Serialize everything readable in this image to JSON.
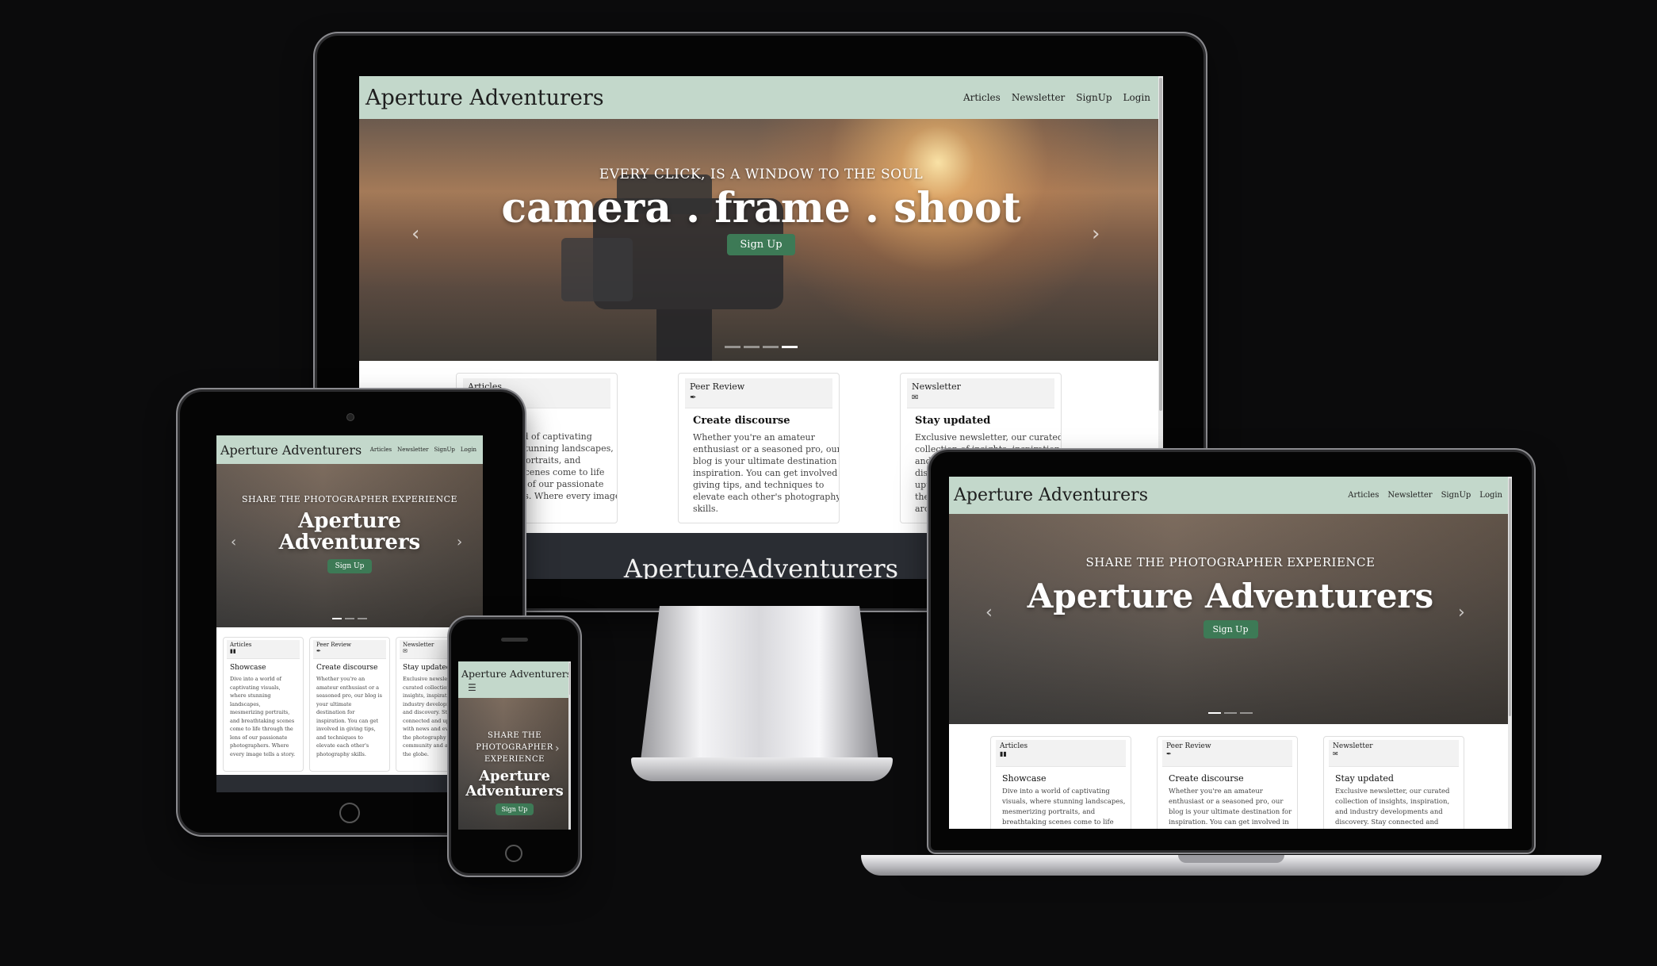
{
  "site": {
    "brand": "Aperture Adventurers",
    "nav": [
      "Articles",
      "Newsletter",
      "SignUp",
      "Login"
    ],
    "signup_button": "Sign Up",
    "footer_brand": "ApertureAdventurers",
    "hero_slides": [
      {
        "kicker": "EVERY CLICK, IS A WINDOW TO THE SOUL",
        "headline": "camera . frame . shoot"
      },
      {
        "kicker": "SHARE THE PHOTOGRAPHER EXPERIENCE",
        "headline": "Aperture Adventurers"
      }
    ],
    "cards": [
      {
        "header": "Articles",
        "icon": "book-icon",
        "title": "Showcase",
        "text": "Dive into a world of captivating visuals, where stunning landscapes, mesmerizing portraits, and breathtaking scenes come to life through the lens of our passionate photographers. Where every image tells a story."
      },
      {
        "header": "Peer Review",
        "icon": "pen-icon",
        "title": "Create discourse",
        "text": "Whether you're an amateur enthusiast or a seasoned pro, our blog is your ultimate destination for inspiration. You can get involved in giving tips, and techniques to elevate each other's photography skills."
      },
      {
        "header": "Newsletter",
        "icon": "envelope-icon",
        "title": "Stay updated",
        "text": "Exclusive newsletter, our curated collection of insights, inspiration, and industry developments and discovery. Stay connected and uptodate with news and events in the photography community and around the globe."
      }
    ]
  },
  "desktop": {
    "card_snippets": [
      "ld of captivating\nstunning landscapes,\nportraits, and\nscenes come to life\ns of our passionate\nrs. Where every image",
      "Whether you're an amateur\nenthusiast or a seasoned pro, our\nblog is your ultimate destination for\ninspiration. You can get involved in\ngiving tips, and techniques to\nelevate each other's photography\nskills.",
      "Exclusive newsletter, our curated\ncollection of insights, inspiration\nand industry developments and\ndisc\nupto\nthe\narou"
    ]
  },
  "tablet": {
    "card_texts": [
      "Dive into a world of\ncaptivating visuals,\nwhere stunning\nlandscapes,\nmesmerizing portraits,\nand breathtaking scenes\ncome to life through the\nlens of our passionate\nphotographers. Where\nevery image tells a story.",
      "Whether you're an\namateur enthusiast or a\nseasoned pro, our blog is\nyour ultimate\ndestination for\ninspiration. You can get\ninvolved in giving tips,\nand techniques to\nelevate each other's\nphotography skills.",
      "Exclusive newslette\ncurated collection o\ninsights, inspiratio\nindustry developm\nand discovery. Stay\nconnected and upto\nwith news and even\nthe photography\ncommunity and aro\nthe globe."
    ]
  },
  "phone": {
    "kicker_lines": [
      "SHARE THE",
      "PHOTOGRAPHER",
      "EXPERIENCE"
    ],
    "headline_lines": [
      "Aperture",
      "Adventurers"
    ]
  },
  "laptop": {
    "card_texts": [
      "Dive into a world of captivating\nvisuals, where stunning landscapes,\nmesmerizing portraits, and\nbreathtaking scenes come to life",
      "Whether you're an amateur\nenthusiast or a seasoned pro, our\nblog is your ultimate destination for\ninspiration. You can get involved in",
      "Exclusive newsletter, our curated\ncollection of insights, inspiration,\nand industry developments and\ndiscovery. Stay connected and"
    ]
  },
  "colors": {
    "nav_bg": "#c3d8cb",
    "button_bg": "#3d7a56",
    "footer_bg": "#2a2d33",
    "backdrop": "#0b0b0c"
  }
}
